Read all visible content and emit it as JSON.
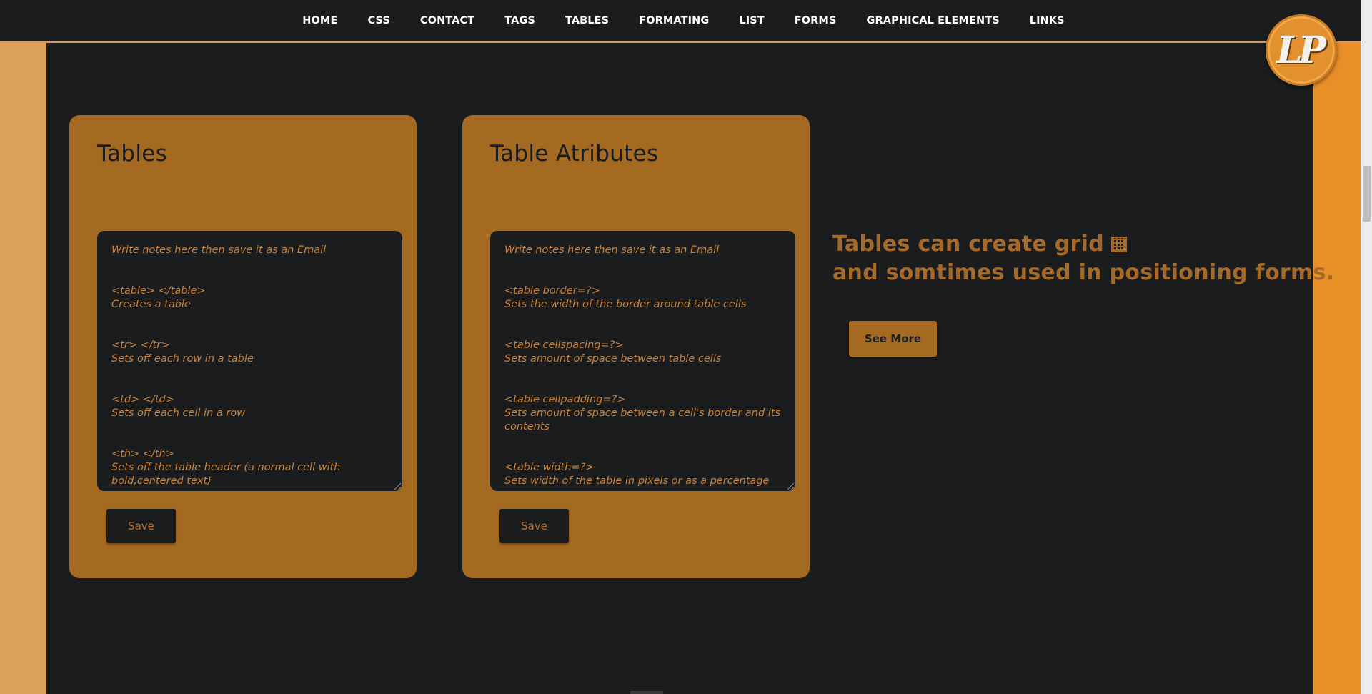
{
  "nav": {
    "items": [
      {
        "label": "HOME"
      },
      {
        "label": "CSS"
      },
      {
        "label": "CONTACT"
      },
      {
        "label": "TAGS"
      },
      {
        "label": "TABLES"
      },
      {
        "label": "FORMATING"
      },
      {
        "label": "LIST"
      },
      {
        "label": "FORMS"
      },
      {
        "label": "GRAPHICAL ELEMENTS"
      },
      {
        "label": "LINKS"
      }
    ]
  },
  "logo": {
    "text": "LP"
  },
  "cards": [
    {
      "title": "Tables",
      "placeholder": "Write notes here then save it as an Email",
      "entries": [
        {
          "tag": "<table> </table>",
          "desc": "Creates a table"
        },
        {
          "tag": "<tr> </tr>",
          "desc": "Sets off each row in a table"
        },
        {
          "tag": "<td> </td>",
          "desc": "Sets off each cell in a row"
        },
        {
          "tag": "<th> </th>",
          "desc": "Sets off the table header (a normal cell with bold,centered text)"
        }
      ],
      "save_label": "Save"
    },
    {
      "title": "Table Atributes",
      "placeholder": "Write notes here then save it as an Email",
      "entries": [
        {
          "tag": "<table border=?>",
          "desc": "Sets the width of the border around table cells"
        },
        {
          "tag": "<table cellspacing=?>",
          "desc": "Sets amount of space between table cells"
        },
        {
          "tag": "<table cellpadding=?>",
          "desc": "Sets amount of space between a cell's border and its contents"
        },
        {
          "tag": "<table width=?>",
          "desc": "Sets width of the table in pixels or as a percentage"
        }
      ],
      "save_label": "Save"
    }
  ],
  "side": {
    "line1": "Tables can create grid",
    "line2": "and somtimes used in positioning forms.",
    "button_label": "See More"
  },
  "colors": {
    "background": "#1b1c1e",
    "card": "#a56a22",
    "accent_text": "#c9823a",
    "left_bar": "#dba05a",
    "right_bar": "#e98f28",
    "logo": "#e3902f"
  },
  "icons": {
    "grid": "grid-icon"
  }
}
